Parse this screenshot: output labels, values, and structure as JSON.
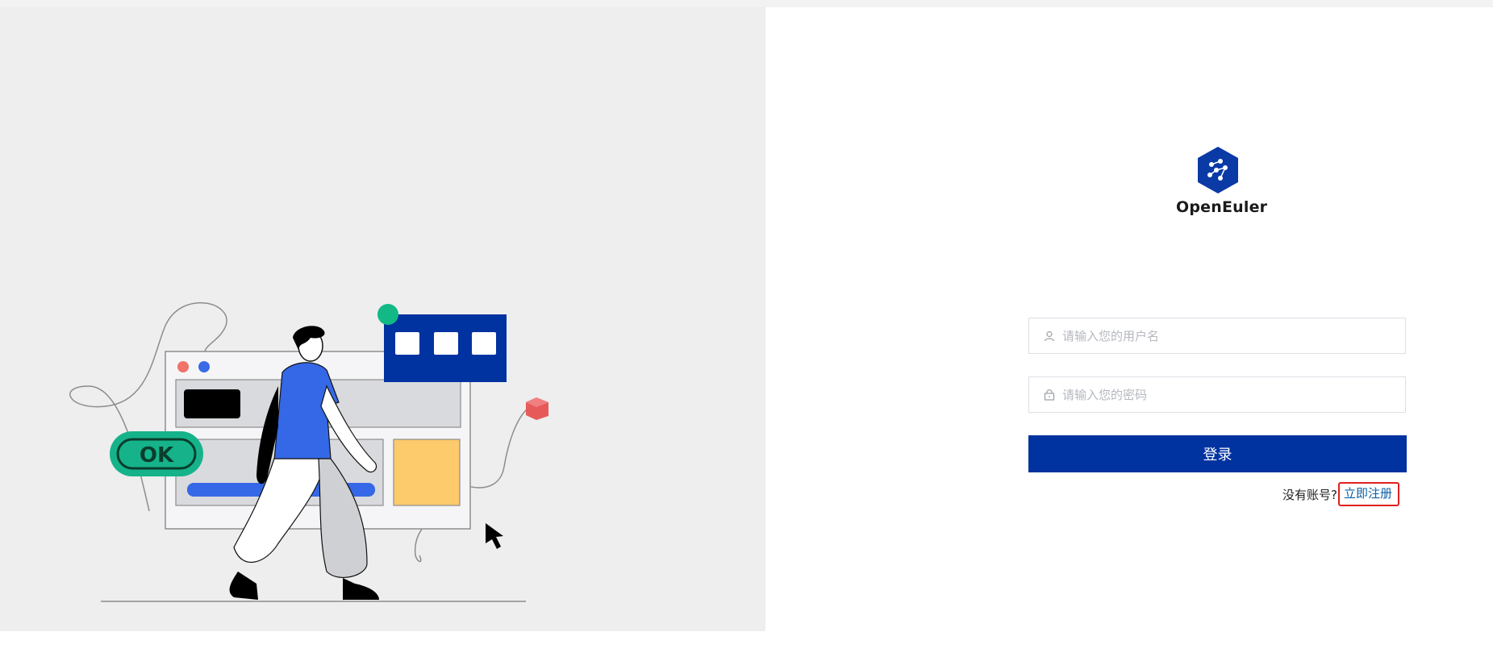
{
  "brand": {
    "name": "OpenEuler",
    "color": "#0a3aa6"
  },
  "illustration": {
    "badge_text": "OK"
  },
  "form": {
    "username": {
      "placeholder": "请输入您的用户名",
      "value": "",
      "icon": "user-icon"
    },
    "password": {
      "placeholder": "请输入您的密码",
      "value": "",
      "icon": "lock-icon"
    },
    "login_label": "登录",
    "no_account_text": "没有账号?",
    "register_label": "立即注册"
  },
  "colors": {
    "primary": "#0032a0",
    "link": "#0b5fa5",
    "highlight": "#e02020",
    "left_bg": "#eeeeee"
  }
}
